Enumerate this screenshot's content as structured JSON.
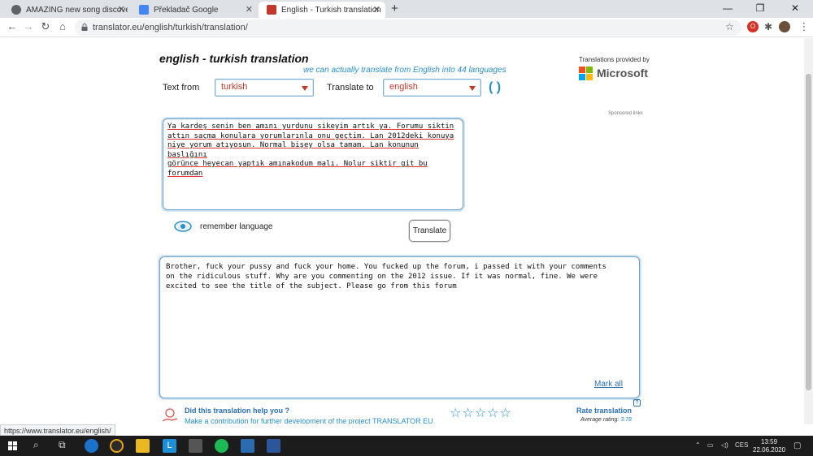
{
  "browser": {
    "tabs": [
      {
        "label": "AMAZING new song discovered"
      },
      {
        "label": "Překladač Google"
      },
      {
        "label": "English - Turkish translation | TR"
      }
    ],
    "new_tab": "+",
    "url": "translator.eu/english/turkish/translation/",
    "status_url": "https://www.translator.eu/english/"
  },
  "page": {
    "title": "english - turkish translation",
    "subtitle": "we can actually translate from English into 44 languages",
    "provider_label": "Translations provided by",
    "provider_name": "Microsoft",
    "sponsored": "Sponsored links",
    "text_from_label": "Text from",
    "text_from_value": "turkish",
    "translate_to_label": "Translate to",
    "translate_to_value": "english",
    "input_lines": [
      "Ya kardeş senin ben amını yurdunu sikeyim artık ya. Forumu siktin",
      "attın saçma konulara yorumlarınla onu geçtim. Lan 2012deki konuya",
      "niye yorum atıyosun. Normal bişey olsa tamam. Lan konunun başlığını",
      "görünce heyecan yaptık amınakodum malı. Nolur siktir git bu",
      "forumdan"
    ],
    "remember_label": "remember language",
    "translate_button": "Translate",
    "output_lines": [
      "Brother, fuck your pussy and fuck your home. You fucked up the forum, i passed it with your comments",
      "on the ridiculous stuff. Why are you commenting on the 2012 issue. If it was normal, fine. We were",
      "excited to see the title of the subject. Please go from this forum"
    ],
    "mark_all": "Mark all",
    "help_marker": "?",
    "help_title": "Did this translation help you ?",
    "help_subtitle": "Make a contribution for further development of the project TRANSLATOR EU",
    "rate_title": "Rate translation",
    "rating_label": "Average rating:",
    "rating_value": "3.78",
    "stars": "☆☆☆☆☆"
  },
  "taskbar": {
    "language": "CES",
    "time": "13:59",
    "date": "22.06.2020"
  },
  "colors": {
    "accent": "#2a8fc7",
    "link": "#2a6fb6",
    "select_text": "#c0392b"
  }
}
